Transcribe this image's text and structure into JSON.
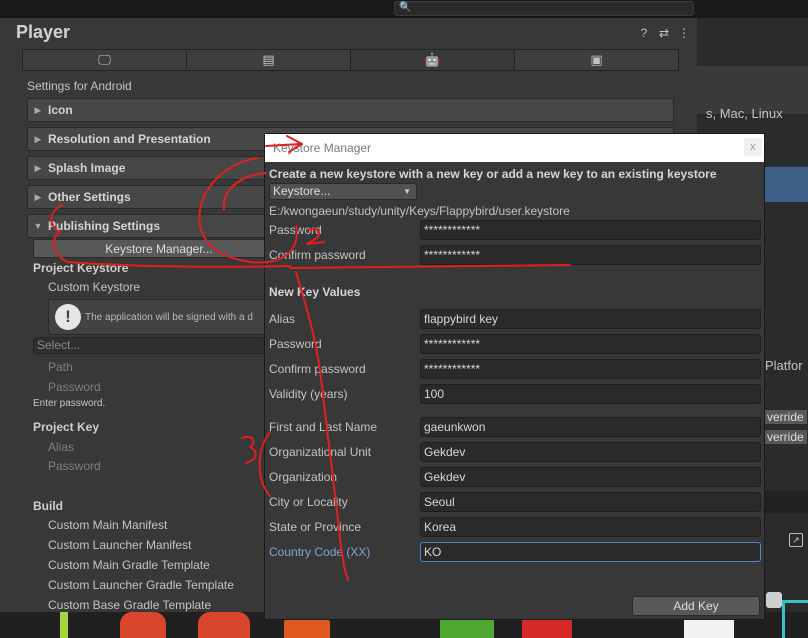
{
  "player": {
    "title": "Player",
    "tools": [
      "?",
      "⇄",
      "⋮"
    ],
    "platform_tabs": [
      {
        "name": "standalone",
        "icon": "monitor-icon",
        "glyph": "🖵"
      },
      {
        "name": "server",
        "icon": "server-icon",
        "glyph": "▤"
      },
      {
        "name": "android",
        "icon": "android-icon",
        "glyph": "🤖"
      },
      {
        "name": "webgl",
        "icon": "html5-icon",
        "glyph": "▣"
      }
    ],
    "settings_for": "Settings for Android",
    "sections": [
      "Icon",
      "Resolution and Presentation",
      "Splash Image",
      "Other Settings",
      "Publishing Settings"
    ],
    "publishing": {
      "keystore_manager_button": "Keystore Manager...",
      "project_keystore": "Project Keystore",
      "custom_keystore": "Custom Keystore",
      "help_text": "The application will be signed with a d",
      "select_placeholder": "Select...",
      "path": "Path",
      "password": "Password",
      "enter_password": "Enter password.",
      "project_key": "Project Key",
      "alias": "Alias",
      "key_password": "Password",
      "build": "Build",
      "build_items": [
        "Custom Main Manifest",
        "Custom Launcher Manifest",
        "Custom Main Gradle Template",
        "Custom Launcher Gradle Template",
        "Custom Base Gradle Template"
      ]
    }
  },
  "right_panel": {
    "platforms_text": "s, Mac, Linux",
    "platform_text2": "Platfor",
    "override1": "verride",
    "override2": "verride"
  },
  "dialog": {
    "title": "Keystore Manager",
    "close": "x",
    "heading": "Create a new keystore with a new key or add a new key to an existing keystore",
    "keystore_dropdown": "Keystore...",
    "path": "E:/kwongaeun/study/unity/Keys/Flappybird/user.keystore",
    "password_label": "Password",
    "password_value": "************",
    "confirm_label": "Confirm password",
    "confirm_value": "************",
    "new_key_heading": "New Key Values",
    "fields": [
      {
        "label": "Alias",
        "value": "flappybird key"
      },
      {
        "label": "Password",
        "value": "************"
      },
      {
        "label": "Confirm password",
        "value": "************"
      },
      {
        "label": "Validity (years)",
        "value": "100"
      },
      {
        "label": "First and Last Name",
        "value": "gaeunkwon"
      },
      {
        "label": "Organizational Unit",
        "value": "Gekdev"
      },
      {
        "label": "Organization",
        "value": "Gekdev"
      },
      {
        "label": "City or Locality",
        "value": "Seoul"
      },
      {
        "label": "State or Province",
        "value": "Korea"
      },
      {
        "label": "Country Code (XX)",
        "value": "KO"
      }
    ],
    "add_key_button": "Add Key"
  },
  "colors": {
    "accent_blue": "#4a86c8",
    "annotation_red": "#e02020"
  }
}
